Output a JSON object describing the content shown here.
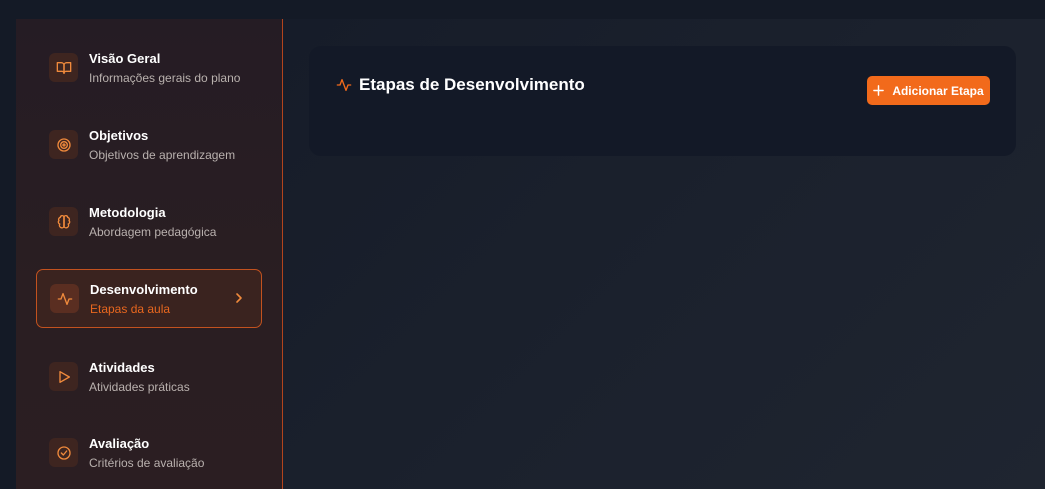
{
  "sidebar": {
    "items": [
      {
        "title": "Visão Geral",
        "subtitle": "Informações gerais do plano",
        "icon": "book-open-icon"
      },
      {
        "title": "Objetivos",
        "subtitle": "Objetivos de aprendizagem",
        "icon": "target-icon"
      },
      {
        "title": "Metodologia",
        "subtitle": "Abordagem pedagógica",
        "icon": "brain-icon"
      },
      {
        "title": "Desenvolvimento",
        "subtitle": "Etapas da aula",
        "icon": "activity-icon",
        "active": true
      },
      {
        "title": "Atividades",
        "subtitle": "Atividades práticas",
        "icon": "play-icon"
      },
      {
        "title": "Avaliação",
        "subtitle": "Critérios de avaliação",
        "icon": "check-circle-icon"
      }
    ]
  },
  "main": {
    "card_title": "Etapas de Desenvolvimento",
    "add_button_label": "Adicionar Etapa"
  },
  "colors": {
    "accent": "#f26a1b",
    "icon": "#f08a3c",
    "active_border": "#c2521f"
  }
}
